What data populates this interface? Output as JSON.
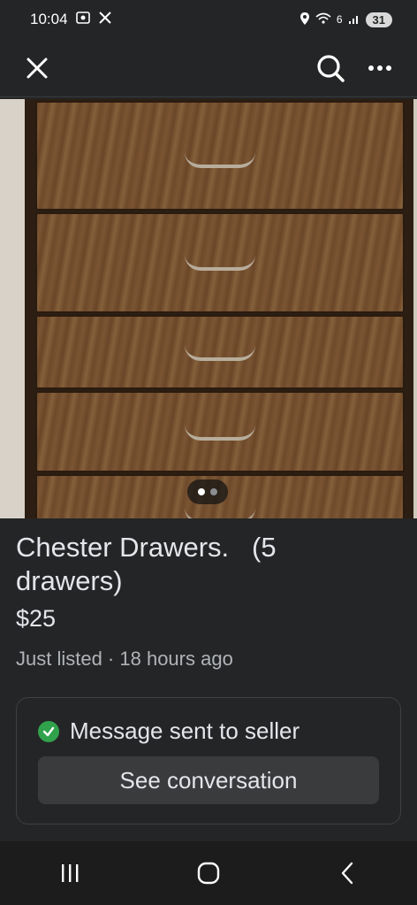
{
  "status": {
    "time": "10:04",
    "battery": "31",
    "network": "6"
  },
  "nav": {
    "close_icon": "close-icon",
    "search_icon": "search-icon",
    "more_icon": "more-icon"
  },
  "carousel": {
    "total": 2,
    "current": 1
  },
  "listing": {
    "title": "Chester Drawers.   (5\ndrawers)",
    "price": "$25",
    "listed": "Just listed · 18 hours ago"
  },
  "message_card": {
    "status_text": "Message sent to seller",
    "button_label": "See conversation",
    "check_color": "#31a24c"
  },
  "system_nav": {
    "recents_icon": "recents-icon",
    "home_icon": "home-icon",
    "back_icon": "back-icon"
  }
}
